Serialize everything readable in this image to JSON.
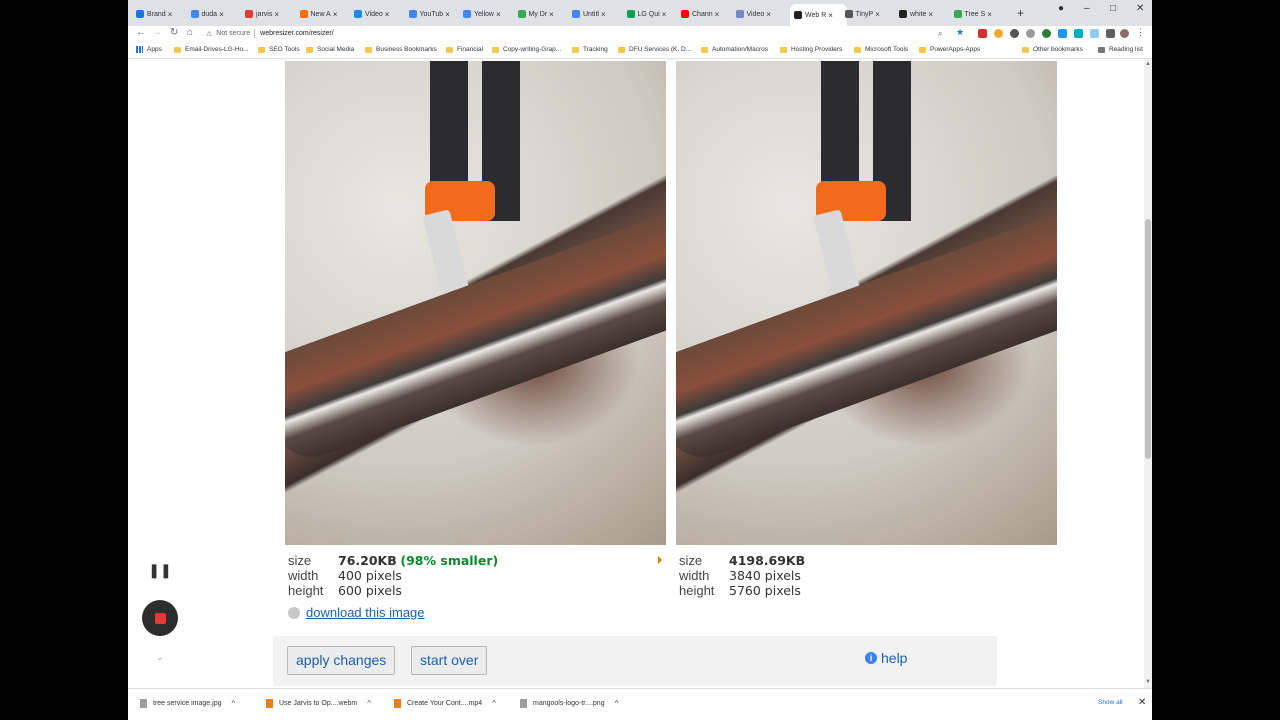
{
  "browser": {
    "tabs": [
      {
        "label": "Brand",
        "color": "#1a73e8"
      },
      {
        "label": "duda",
        "color": "#4285f4"
      },
      {
        "label": "jarvis",
        "color": "#e53935"
      },
      {
        "label": "New A",
        "color": "#ff6f00"
      },
      {
        "label": "Video",
        "color": "#1e88e5"
      },
      {
        "label": "YouTub",
        "color": "#4285f4"
      },
      {
        "label": "Yellow",
        "color": "#4285f4"
      },
      {
        "label": "My Dr",
        "color": "#34a853"
      },
      {
        "label": "Untitl",
        "color": "#4285f4"
      },
      {
        "label": "LG Qui",
        "color": "#0f9d58"
      },
      {
        "label": "Chann",
        "color": "#ff0000"
      },
      {
        "label": "Video",
        "color": "#7986cb"
      },
      {
        "label": "Web R",
        "color": "#222222"
      },
      {
        "label": "TinyP",
        "color": "#555555"
      },
      {
        "label": "white",
        "color": "#222222"
      },
      {
        "label": "Tree S",
        "color": "#34a853"
      }
    ],
    "active_tab_index": 12,
    "security_label": "Not secure",
    "url": "webresizer.com/resizer/",
    "bookmarks": [
      {
        "label": "Apps",
        "type": "apps"
      },
      {
        "label": "Email-Drives-LG-Ho...",
        "type": "folder"
      },
      {
        "label": "SEO Tools",
        "type": "folder"
      },
      {
        "label": "Social Media",
        "type": "folder"
      },
      {
        "label": "Business Bookmarks",
        "type": "folder"
      },
      {
        "label": "Financial",
        "type": "folder"
      },
      {
        "label": "Copy-writing-Grap...",
        "type": "folder"
      },
      {
        "label": "Tracking",
        "type": "folder"
      },
      {
        "label": "DFU Services (K. D...",
        "type": "folder"
      },
      {
        "label": "Automation/Macros",
        "type": "folder"
      },
      {
        "label": "Hosting Providers",
        "type": "folder"
      },
      {
        "label": "Microsoft Tools",
        "type": "folder"
      },
      {
        "label": "PowerApps-Apps",
        "type": "folder"
      },
      {
        "label": "Other bookmarks",
        "type": "folder"
      },
      {
        "label": "Reading list",
        "type": "list"
      }
    ]
  },
  "resized": {
    "size_label": "size",
    "size_value": "76.20KB",
    "size_note": "(98% smaller)",
    "width_label": "width",
    "width_value": "400 pixels",
    "height_label": "height",
    "height_value": "600 pixels",
    "download_label": "download this image"
  },
  "original": {
    "size_label": "size",
    "size_value": "4198.69KB",
    "width_label": "width",
    "width_value": "3840 pixels",
    "height_label": "height",
    "height_value": "5760 pixels"
  },
  "actions": {
    "apply_label": "apply changes",
    "start_over_label": "start over",
    "help_label": "help"
  },
  "downloads": [
    {
      "name": "tree service image.jpg",
      "type": "image"
    },
    {
      "name": "Use Jarvis to Op....webm",
      "type": "video"
    },
    {
      "name": "Create Your Cont....mp4",
      "type": "video"
    },
    {
      "name": "mangools-logo-tr....png",
      "type": "image"
    }
  ],
  "downloads_show_all": "Show all"
}
